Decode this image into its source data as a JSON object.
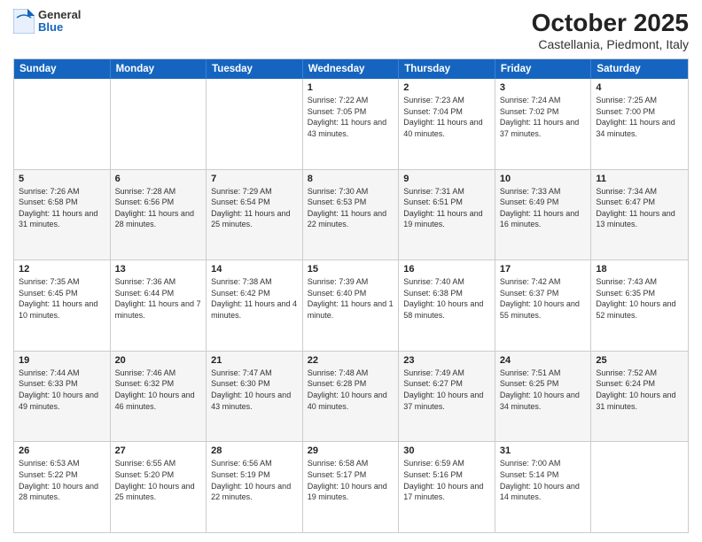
{
  "logo": {
    "general": "General",
    "blue": "Blue"
  },
  "title": "October 2025",
  "subtitle": "Castellania, Piedmont, Italy",
  "header_days": [
    "Sunday",
    "Monday",
    "Tuesday",
    "Wednesday",
    "Thursday",
    "Friday",
    "Saturday"
  ],
  "rows": [
    [
      {
        "day": "",
        "info": ""
      },
      {
        "day": "",
        "info": ""
      },
      {
        "day": "",
        "info": ""
      },
      {
        "day": "1",
        "info": "Sunrise: 7:22 AM\nSunset: 7:05 PM\nDaylight: 11 hours and 43 minutes."
      },
      {
        "day": "2",
        "info": "Sunrise: 7:23 AM\nSunset: 7:04 PM\nDaylight: 11 hours and 40 minutes."
      },
      {
        "day": "3",
        "info": "Sunrise: 7:24 AM\nSunset: 7:02 PM\nDaylight: 11 hours and 37 minutes."
      },
      {
        "day": "4",
        "info": "Sunrise: 7:25 AM\nSunset: 7:00 PM\nDaylight: 11 hours and 34 minutes."
      }
    ],
    [
      {
        "day": "5",
        "info": "Sunrise: 7:26 AM\nSunset: 6:58 PM\nDaylight: 11 hours and 31 minutes."
      },
      {
        "day": "6",
        "info": "Sunrise: 7:28 AM\nSunset: 6:56 PM\nDaylight: 11 hours and 28 minutes."
      },
      {
        "day": "7",
        "info": "Sunrise: 7:29 AM\nSunset: 6:54 PM\nDaylight: 11 hours and 25 minutes."
      },
      {
        "day": "8",
        "info": "Sunrise: 7:30 AM\nSunset: 6:53 PM\nDaylight: 11 hours and 22 minutes."
      },
      {
        "day": "9",
        "info": "Sunrise: 7:31 AM\nSunset: 6:51 PM\nDaylight: 11 hours and 19 minutes."
      },
      {
        "day": "10",
        "info": "Sunrise: 7:33 AM\nSunset: 6:49 PM\nDaylight: 11 hours and 16 minutes."
      },
      {
        "day": "11",
        "info": "Sunrise: 7:34 AM\nSunset: 6:47 PM\nDaylight: 11 hours and 13 minutes."
      }
    ],
    [
      {
        "day": "12",
        "info": "Sunrise: 7:35 AM\nSunset: 6:45 PM\nDaylight: 11 hours and 10 minutes."
      },
      {
        "day": "13",
        "info": "Sunrise: 7:36 AM\nSunset: 6:44 PM\nDaylight: 11 hours and 7 minutes."
      },
      {
        "day": "14",
        "info": "Sunrise: 7:38 AM\nSunset: 6:42 PM\nDaylight: 11 hours and 4 minutes."
      },
      {
        "day": "15",
        "info": "Sunrise: 7:39 AM\nSunset: 6:40 PM\nDaylight: 11 hours and 1 minute."
      },
      {
        "day": "16",
        "info": "Sunrise: 7:40 AM\nSunset: 6:38 PM\nDaylight: 10 hours and 58 minutes."
      },
      {
        "day": "17",
        "info": "Sunrise: 7:42 AM\nSunset: 6:37 PM\nDaylight: 10 hours and 55 minutes."
      },
      {
        "day": "18",
        "info": "Sunrise: 7:43 AM\nSunset: 6:35 PM\nDaylight: 10 hours and 52 minutes."
      }
    ],
    [
      {
        "day": "19",
        "info": "Sunrise: 7:44 AM\nSunset: 6:33 PM\nDaylight: 10 hours and 49 minutes."
      },
      {
        "day": "20",
        "info": "Sunrise: 7:46 AM\nSunset: 6:32 PM\nDaylight: 10 hours and 46 minutes."
      },
      {
        "day": "21",
        "info": "Sunrise: 7:47 AM\nSunset: 6:30 PM\nDaylight: 10 hours and 43 minutes."
      },
      {
        "day": "22",
        "info": "Sunrise: 7:48 AM\nSunset: 6:28 PM\nDaylight: 10 hours and 40 minutes."
      },
      {
        "day": "23",
        "info": "Sunrise: 7:49 AM\nSunset: 6:27 PM\nDaylight: 10 hours and 37 minutes."
      },
      {
        "day": "24",
        "info": "Sunrise: 7:51 AM\nSunset: 6:25 PM\nDaylight: 10 hours and 34 minutes."
      },
      {
        "day": "25",
        "info": "Sunrise: 7:52 AM\nSunset: 6:24 PM\nDaylight: 10 hours and 31 minutes."
      }
    ],
    [
      {
        "day": "26",
        "info": "Sunrise: 6:53 AM\nSunset: 5:22 PM\nDaylight: 10 hours and 28 minutes."
      },
      {
        "day": "27",
        "info": "Sunrise: 6:55 AM\nSunset: 5:20 PM\nDaylight: 10 hours and 25 minutes."
      },
      {
        "day": "28",
        "info": "Sunrise: 6:56 AM\nSunset: 5:19 PM\nDaylight: 10 hours and 22 minutes."
      },
      {
        "day": "29",
        "info": "Sunrise: 6:58 AM\nSunset: 5:17 PM\nDaylight: 10 hours and 19 minutes."
      },
      {
        "day": "30",
        "info": "Sunrise: 6:59 AM\nSunset: 5:16 PM\nDaylight: 10 hours and 17 minutes."
      },
      {
        "day": "31",
        "info": "Sunrise: 7:00 AM\nSunset: 5:14 PM\nDaylight: 10 hours and 14 minutes."
      },
      {
        "day": "",
        "info": ""
      }
    ]
  ]
}
